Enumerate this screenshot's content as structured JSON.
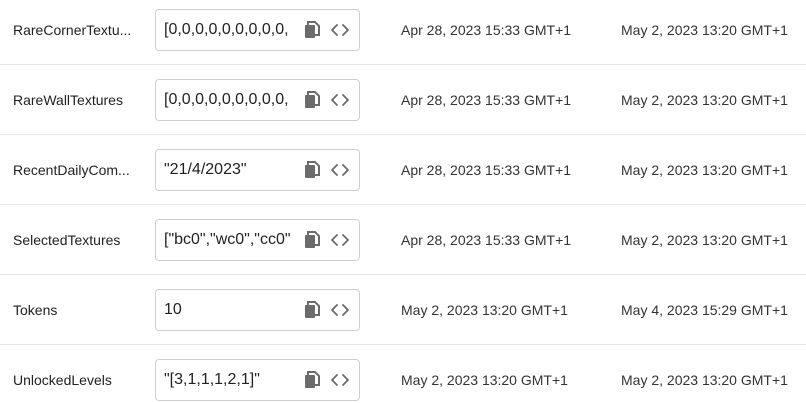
{
  "rows": [
    {
      "key": "RareCornerTextu...",
      "value": "[0,0,0,0,0,0,0,0,0,",
      "created": "Apr 28, 2023 15:33 GMT+1",
      "updated": "May 2, 2023 13:20 GMT+1"
    },
    {
      "key": "RareWallTextures",
      "value": "[0,0,0,0,0,0,0,0,0,",
      "created": "Apr 28, 2023 15:33 GMT+1",
      "updated": "May 2, 2023 13:20 GMT+1"
    },
    {
      "key": "RecentDailyCom...",
      "value": "\"21/4/2023\"",
      "created": "Apr 28, 2023 15:33 GMT+1",
      "updated": "May 2, 2023 13:20 GMT+1"
    },
    {
      "key": "SelectedTextures",
      "value": "[\"bc0\",\"wc0\",\"cc0\"",
      "created": "Apr 28, 2023 15:33 GMT+1",
      "updated": "May 2, 2023 13:20 GMT+1"
    },
    {
      "key": "Tokens",
      "value": "10",
      "created": "May 2, 2023 13:20 GMT+1",
      "updated": "May 4, 2023 15:29 GMT+1"
    },
    {
      "key": "UnlockedLevels",
      "value": "\"[3,1,1,1,2,1]\"",
      "created": "May 2, 2023 13:20 GMT+1",
      "updated": "May 2, 2023 13:20 GMT+1"
    }
  ],
  "icons": {
    "copy": "copy-icon",
    "code": "code-icon"
  },
  "colors": {
    "border": "#cfcfcf",
    "divider": "#e6e6e6",
    "icon": "#6b6b6b"
  }
}
